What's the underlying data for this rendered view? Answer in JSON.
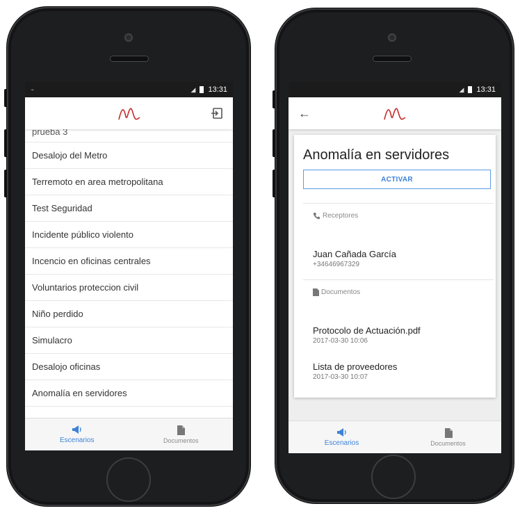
{
  "left_phone": {
    "status": {
      "time": "13:31"
    },
    "list_items": [
      "prueba 3",
      "Desalojo del Metro",
      "Terremoto en area metropolitana",
      "Test Seguridad",
      "Incidente público violento",
      "Incencio en oficinas centrales",
      "Voluntarios proteccion civil",
      "Niño perdido",
      "Simulacro",
      "Desalojo oficinas",
      "Anomalía en servidores"
    ],
    "nav": {
      "scenarios": "Escenarios",
      "documents": "Documentos"
    }
  },
  "right_phone": {
    "status": {
      "time": "13:31"
    },
    "title": "Anomalía en servidores",
    "activate_label": "ACTIVAR",
    "receivers_header": "Receptores",
    "receiver": {
      "name": "Juan Cañada García",
      "phone": "+34646967329"
    },
    "documents_header": "Documentos",
    "documents": [
      {
        "name": "Protocolo de Actuación.pdf",
        "date": "2017-03-30 10:06"
      },
      {
        "name": "Lista de proveedores",
        "date": "2017-03-30 10:07"
      }
    ],
    "nav": {
      "scenarios": "Escenarios",
      "documents": "Documentos"
    }
  },
  "colors": {
    "accent": "#3d82d8",
    "logo": "#c62a2a"
  },
  "icons": {
    "logo": "brand-logo-icon",
    "logout": "logout-icon",
    "back": "arrow-back-icon",
    "megaphone": "megaphone-icon",
    "document": "document-icon",
    "phone": "phone-icon"
  }
}
